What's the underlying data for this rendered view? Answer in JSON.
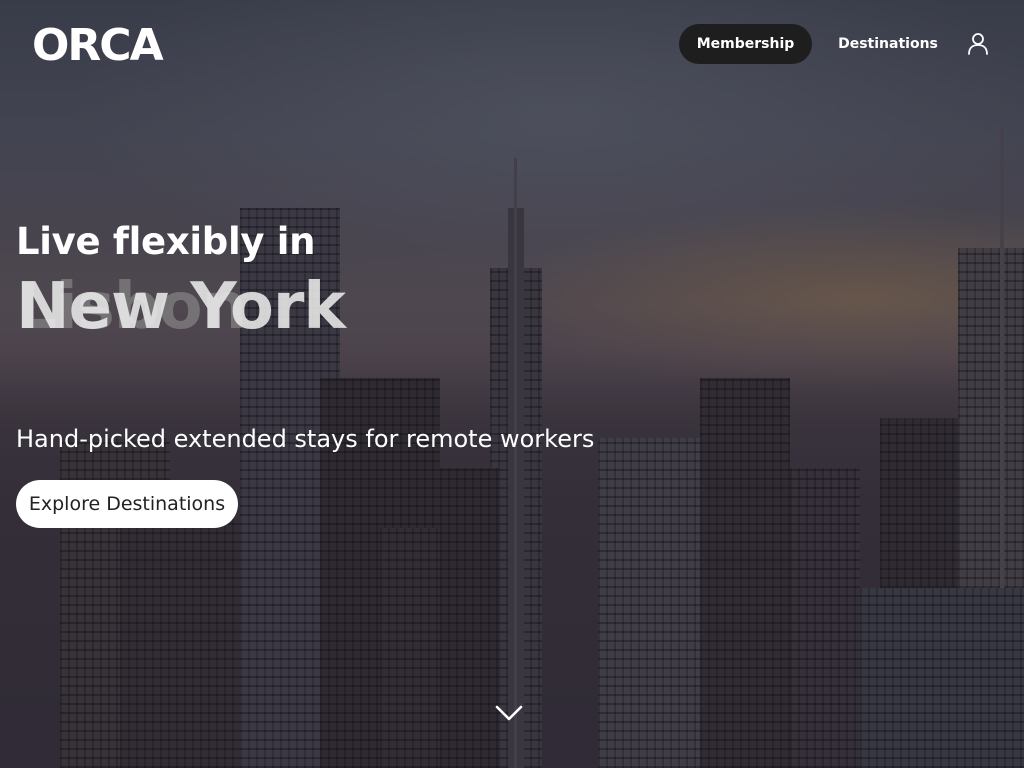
{
  "brand": {
    "logo_text": "ORCA"
  },
  "nav": {
    "membership_label": "Membership",
    "destinations_label": "Destinations",
    "account_icon": "user-icon"
  },
  "hero": {
    "eyebrow": "Live flexibly in",
    "city_ghost": "Lisbon",
    "city": "New York",
    "subtitle": "Hand-picked extended stays for remote workers",
    "cta_label": "Explore Destinations",
    "scroll_icon": "chevron-down-icon"
  },
  "colors": {
    "nav_active_bg": "#1e1e1e",
    "cta_bg": "#ffffff",
    "text": "#ffffff"
  }
}
